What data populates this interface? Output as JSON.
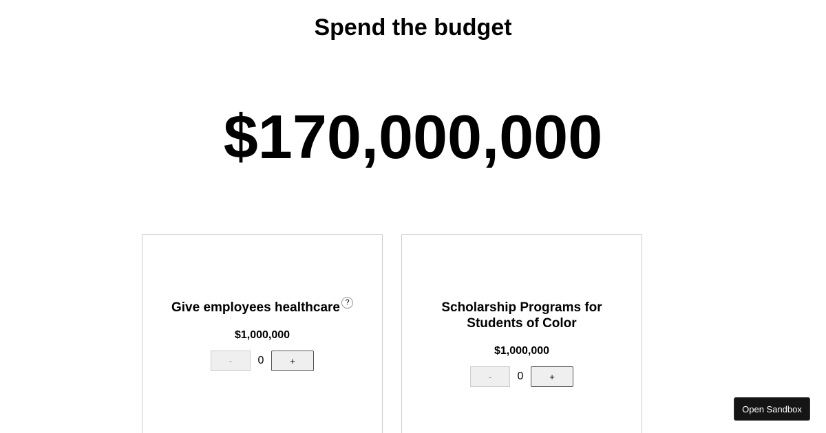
{
  "header": {
    "title": "Spend the budget"
  },
  "budget": {
    "amount": "$170,000,000"
  },
  "cards": [
    {
      "title": "Give employees healthcare",
      "help": "?",
      "price": "$1,000,000",
      "minus_label": "-",
      "quantity": "0",
      "plus_label": "+"
    },
    {
      "title": "Scholarship Programs for Students of Color",
      "price": "$1,000,000",
      "minus_label": "-",
      "quantity": "0",
      "plus_label": "+"
    }
  ],
  "sandbox": {
    "label": "Open Sandbox"
  }
}
